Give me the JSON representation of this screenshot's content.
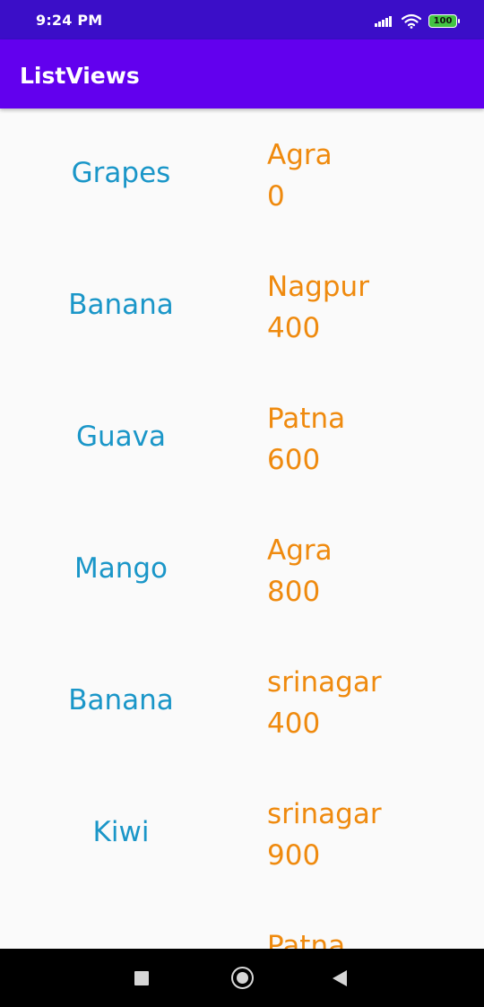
{
  "status_bar": {
    "time": "9:24 PM",
    "battery_level": "100",
    "icons": [
      "signal-icon",
      "wifi-icon",
      "battery-icon"
    ]
  },
  "app_bar": {
    "title": "ListViews",
    "color": "#6200ee"
  },
  "list": {
    "columns": [
      "fruit",
      "city",
      "amount"
    ],
    "fruit_color": "#1a96c8",
    "city_color": "#ef8a0e",
    "items": [
      {
        "fruit": "Grapes",
        "city": "Agra",
        "amount": "0"
      },
      {
        "fruit": "Banana",
        "city": "Nagpur",
        "amount": "400"
      },
      {
        "fruit": "Guava",
        "city": "Patna",
        "amount": "600"
      },
      {
        "fruit": "Mango",
        "city": "Agra",
        "amount": "800"
      },
      {
        "fruit": "Banana",
        "city": "srinagar",
        "amount": "400"
      },
      {
        "fruit": "Kiwi",
        "city": "srinagar",
        "amount": "900"
      },
      {
        "fruit": "",
        "city": "Patna",
        "amount": ""
      }
    ]
  },
  "nav_bar": {
    "buttons": [
      "recents-icon",
      "home-icon",
      "back-icon"
    ]
  }
}
